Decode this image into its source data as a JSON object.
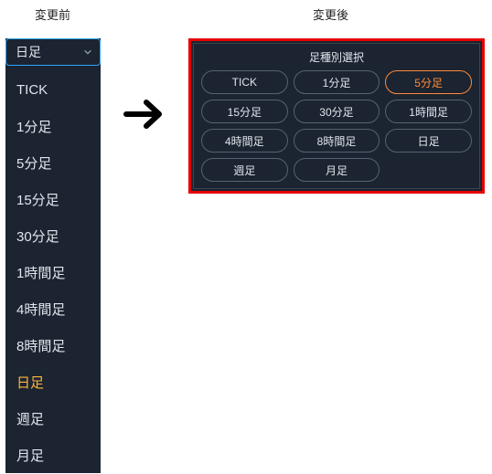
{
  "headers": {
    "before": "変更前",
    "after": "変更後"
  },
  "colors": {
    "highlight_red": "#e60000",
    "accent_orange": "#ff8a3a",
    "item_highlight": "#ffb640",
    "focus_blue": "#2aa6ff",
    "panel_bg": "#1b2430",
    "text": "#dfe6ee"
  },
  "dropdown": {
    "selected": "日足",
    "items": [
      {
        "label": "TICK",
        "highlighted": false
      },
      {
        "label": "1分足",
        "highlighted": false
      },
      {
        "label": "5分足",
        "highlighted": false
      },
      {
        "label": "15分足",
        "highlighted": false
      },
      {
        "label": "30分足",
        "highlighted": false
      },
      {
        "label": "1時間足",
        "highlighted": false
      },
      {
        "label": "4時間足",
        "highlighted": false
      },
      {
        "label": "8時間足",
        "highlighted": false
      },
      {
        "label": "日足",
        "highlighted": true
      },
      {
        "label": "週足",
        "highlighted": false
      },
      {
        "label": "月足",
        "highlighted": false
      }
    ]
  },
  "panel": {
    "title": "足種別選択",
    "chips": [
      {
        "label": "TICK",
        "active": false
      },
      {
        "label": "1分足",
        "active": false
      },
      {
        "label": "5分足",
        "active": true
      },
      {
        "label": "15分足",
        "active": false
      },
      {
        "label": "30分足",
        "active": false
      },
      {
        "label": "1時間足",
        "active": false
      },
      {
        "label": "4時間足",
        "active": false
      },
      {
        "label": "8時間足",
        "active": false
      },
      {
        "label": "日足",
        "active": false
      },
      {
        "label": "週足",
        "active": false
      },
      {
        "label": "月足",
        "active": false
      }
    ]
  }
}
